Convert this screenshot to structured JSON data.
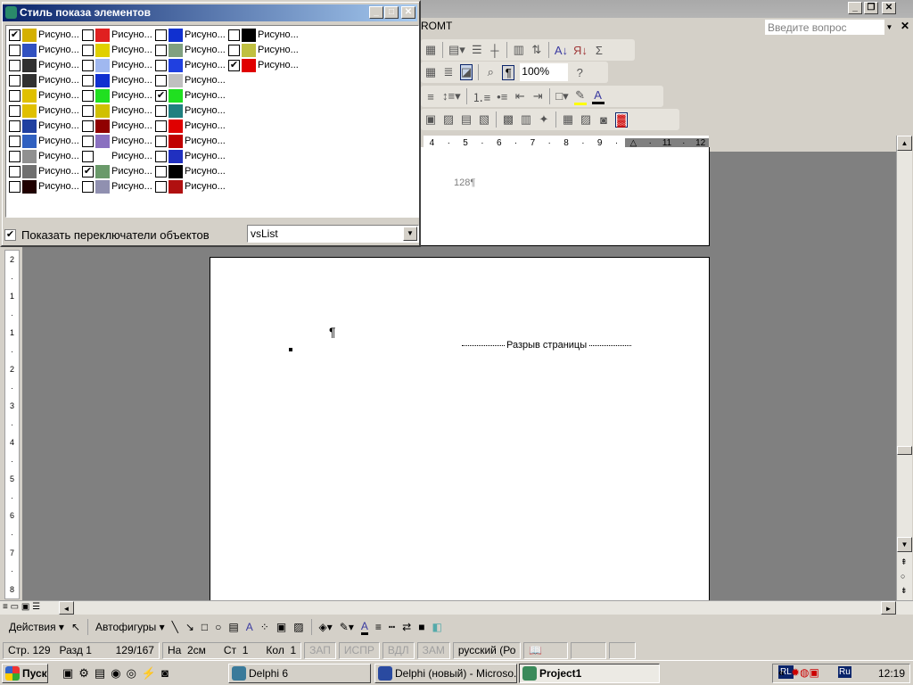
{
  "word": {
    "menu_partial": "ROMT",
    "help_placeholder": "Введите вопрос",
    "zoom": "100%",
    "ruler": [
      "4",
      "·",
      "5",
      "·",
      "6",
      "·",
      "7",
      "·",
      "8",
      "·",
      "9",
      "·",
      "△",
      "·",
      "11",
      "·",
      "12"
    ],
    "vruler": [
      "2",
      "·",
      "1",
      "·",
      "1",
      "·",
      "2",
      "·",
      "3",
      "·",
      "4",
      "·",
      "5",
      "·",
      "6",
      "·",
      "7",
      "·",
      "8"
    ],
    "page1_text": "128¶",
    "pilcrow": "¶",
    "page_break": "Разрыв страницы",
    "drawing": {
      "actions": "Действия ▾",
      "autoshapes": "Автофигуры ▾"
    },
    "status": [
      {
        "text": "Стр. 129   Разд 1        129/167",
        "dis": false
      },
      {
        "text": "На  2см      Ст  1      Кол  1",
        "dis": false
      },
      {
        "text": "ЗАП",
        "dis": true
      },
      {
        "text": "ИСПР",
        "dis": true
      },
      {
        "text": "ВДЛ",
        "dis": true
      },
      {
        "text": "ЗАМ",
        "dis": true
      },
      {
        "text": "русский (Ро",
        "dis": false
      }
    ]
  },
  "taskbar": {
    "start": "Пуск",
    "tasks": [
      {
        "label": "Delphi 6",
        "color": "#3a7a9a",
        "active": false
      },
      {
        "label": "Delphi (новый) - Microso...",
        "color": "#2a4aa0",
        "active": false
      },
      {
        "label": "Project1",
        "color": "#3a8a5a",
        "active": true
      }
    ],
    "lang": "RL",
    "tray_lang": "Ru",
    "clock": "12:19"
  },
  "dialog": {
    "title": "Стиль показа элементов",
    "item_label": "Рисуно...",
    "columns": [
      [
        {
          "c": "#d4b000",
          "k": true
        },
        {
          "c": "#3050c0",
          "k": false
        },
        {
          "c": "#303030",
          "k": false
        },
        {
          "c": "#303030",
          "k": false
        },
        {
          "c": "#e0c000",
          "k": false
        },
        {
          "c": "#e0c000",
          "k": false
        },
        {
          "c": "#2040a0",
          "k": false
        },
        {
          "c": "#3060c0",
          "k": false
        },
        {
          "c": "#909090",
          "k": false
        },
        {
          "c": "#707070",
          "k": false
        },
        {
          "c": "#200000",
          "k": false
        }
      ],
      [
        {
          "c": "#e02020",
          "k": false
        },
        {
          "c": "#e0d000",
          "k": false
        },
        {
          "c": "#a0b8f0",
          "k": false
        },
        {
          "c": "#1030d0",
          "k": false
        },
        {
          "c": "#20e020",
          "k": false
        },
        {
          "c": "#d0c000",
          "k": false
        },
        {
          "c": "#900000",
          "k": false
        },
        {
          "c": "#8a70c0",
          "k": false
        },
        {
          "c": "#ffffff",
          "k": false
        },
        {
          "c": "#6a9a6a",
          "k": true
        },
        {
          "c": "#9090b0",
          "k": false
        }
      ],
      [
        {
          "c": "#1030d0",
          "k": false
        },
        {
          "c": "#80a080",
          "k": false
        },
        {
          "c": "#2040e0",
          "k": false
        },
        {
          "c": "#c0c0c0",
          "k": false
        },
        {
          "c": "#20e020",
          "k": true
        },
        {
          "c": "#208080",
          "k": false
        },
        {
          "c": "#e00000",
          "k": false
        },
        {
          "c": "#c00000",
          "k": false
        },
        {
          "c": "#2030c0",
          "k": false
        },
        {
          "c": "#000000",
          "k": false
        },
        {
          "c": "#b01010",
          "k": false
        }
      ],
      [
        {
          "c": "#000000",
          "k": false
        },
        {
          "c": "#c0c040",
          "k": false
        },
        {
          "c": "#e00000",
          "k": true
        }
      ]
    ],
    "show_switches_label": "Показать переключатели объектов",
    "show_switches_checked": true,
    "style_value": "vsList"
  }
}
